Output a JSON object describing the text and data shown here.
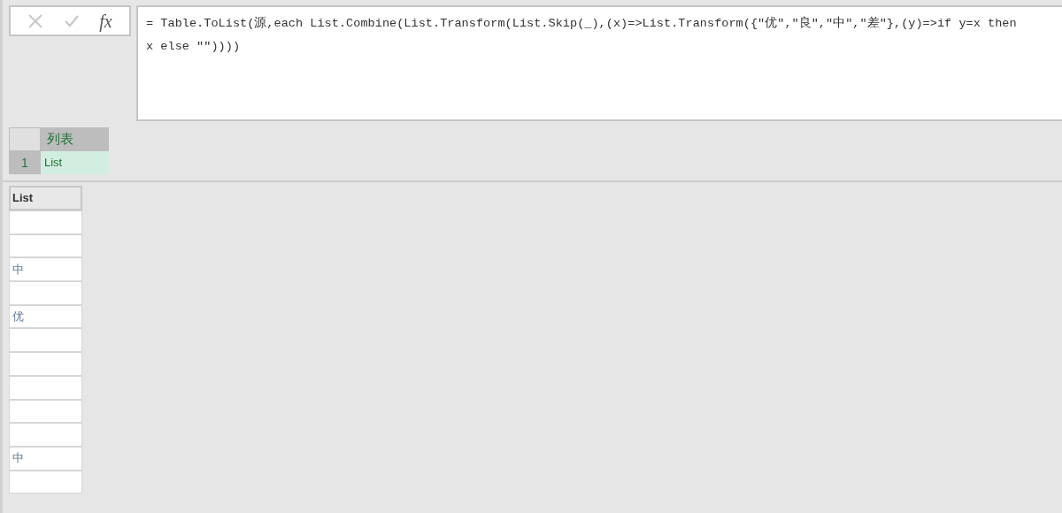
{
  "formula_bar": {
    "cancel_disabled": true,
    "confirm_disabled": true,
    "fx_label": "fx",
    "formula_lines": [
      "= Table.ToList(源,each List.Combine(List.Transform(List.Skip(_),(x)=>List.Transform({\"优\",\"良\",\"中\",\"差\"},(y)=>if y=x then",
      "x else \"\"))))"
    ]
  },
  "preview_table": {
    "column": "列表",
    "rows": [
      {
        "index": "1",
        "value": "List",
        "selected": true
      }
    ]
  },
  "list_table": {
    "column": "List",
    "rows": [
      {
        "kind": "blank"
      },
      {
        "kind": "blank"
      },
      {
        "kind": "text",
        "value": "中"
      },
      {
        "kind": "blank"
      },
      {
        "kind": "text",
        "value": "优"
      },
      {
        "kind": "blank"
      },
      {
        "kind": "blank"
      },
      {
        "kind": "blank"
      },
      {
        "kind": "blank"
      },
      {
        "kind": "blank"
      },
      {
        "kind": "text",
        "value": "中"
      },
      {
        "kind": "blank"
      }
    ]
  }
}
